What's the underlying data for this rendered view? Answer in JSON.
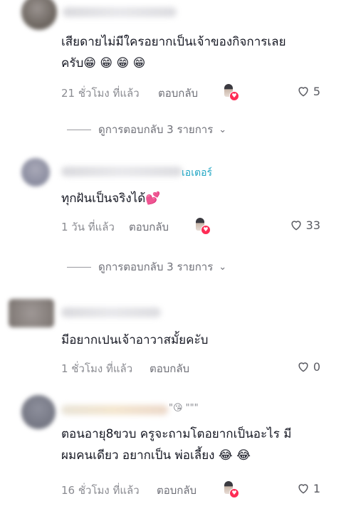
{
  "comments": [
    {
      "text_lines": [
        "เสียดายไม่มีใครอยากเป็นเจ้าของกิจการเลย",
        "ครับ😁 😁 😁 😁"
      ],
      "time": "21 ชั่วโมง ที่แล้ว",
      "reply_label": "ตอบกลับ",
      "likes": "5",
      "view_replies": "ดูการตอบกลับ 3 รายการ"
    },
    {
      "name_tag": "เอเตอร์",
      "text_lines": [
        "ทุกฝันเป็นจริงได้💕"
      ],
      "time": "1 วัน ที่แล้ว",
      "reply_label": "ตอบกลับ",
      "likes": "33",
      "view_replies": "ดูการตอบกลับ 3 รายการ"
    },
    {
      "text_lines": [
        "มีอยากเปนเจ้าอาวาสมั้ยคะับ"
      ],
      "time": "1 ชั่วโมง ที่แล้ว",
      "reply_label": "ตอบกลับ",
      "likes": "0"
    },
    {
      "name_tail": "\"😘 \"\"\"",
      "text_lines": [
        "ตอนอายุ8ขวบ ครูจะถามโตอยากเป็นอะไร มี",
        "ผมคนเดียว อยากเป็น พ่อเลี้ยง 😂 😂"
      ],
      "time": "16 ชั่วโมง ที่แล้ว",
      "reply_label": "ตอบกลับ",
      "likes": "1"
    }
  ],
  "icons": {
    "like": "heart-outline-icon",
    "expand": "chevron-down-icon",
    "creator": "creator-avatar-icon"
  },
  "colors": {
    "text": "#161823",
    "muted": "#8a8b91",
    "creator_badge": "#fe2c55",
    "name_tag": "#22a6c4"
  }
}
